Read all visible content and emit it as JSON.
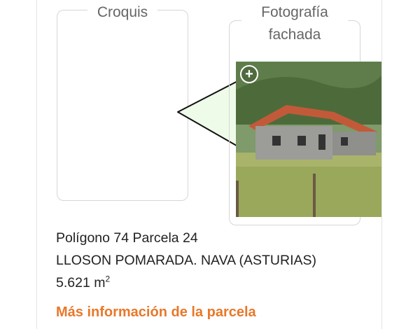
{
  "sketch": {
    "caption": "Croquis"
  },
  "photo": {
    "caption": "Fotografía fachada"
  },
  "parcel": {
    "line1": "Polígono 74 Parcela 24",
    "line2": "LLOSON POMARADA. NAVA (ASTURIAS)",
    "area_value": "5.621 m",
    "area_exp": "2"
  },
  "more_link": {
    "label": "Más información de la parcela"
  },
  "icons": {
    "zoom": "zoom-in-icon"
  },
  "colors": {
    "accent": "#e8782a",
    "sketch_fill": "#eefbe8"
  }
}
